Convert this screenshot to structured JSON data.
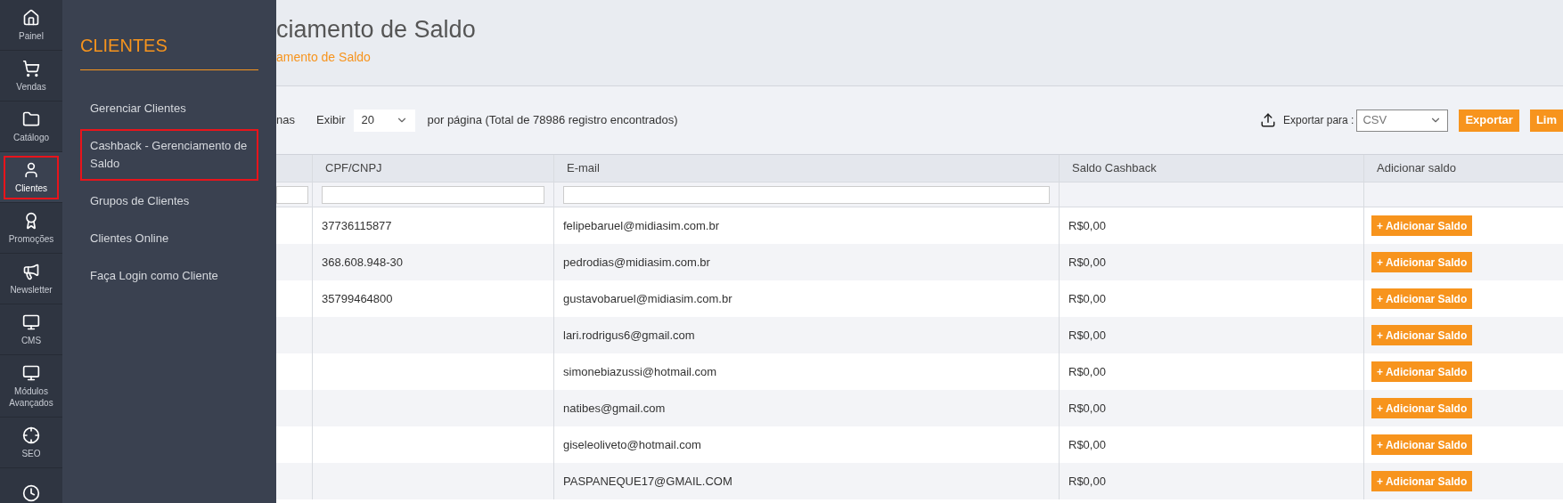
{
  "sidebar": {
    "items": [
      {
        "label": "Painel",
        "selected": false
      },
      {
        "label": "Vendas",
        "selected": false
      },
      {
        "label": "Catálogo",
        "selected": false
      },
      {
        "label": "Clientes",
        "selected": true
      },
      {
        "label": "Promoções",
        "selected": false
      },
      {
        "label": "Newsletter",
        "selected": false
      },
      {
        "label": "CMS",
        "selected": false
      },
      {
        "label": "Módulos Avançados",
        "selected": false
      },
      {
        "label": "SEO",
        "selected": false
      },
      {
        "selected": false
      }
    ]
  },
  "flyout": {
    "title": "CLIENTES",
    "items": [
      {
        "label": "Gerenciar Clientes",
        "selected": false
      },
      {
        "label": "Cashback - Gerenciamento de Saldo",
        "selected": true
      },
      {
        "label": "Grupos de Clientes",
        "selected": false
      },
      {
        "label": "Clientes Online",
        "selected": false
      },
      {
        "label": "Faça Login como Cliente",
        "selected": false
      }
    ]
  },
  "header": {
    "title": "ciamento de Saldo",
    "breadcrumb": "amento de Saldo"
  },
  "toolbar": {
    "pages_label": "nas",
    "show_label": "Exibir",
    "per_page": "20",
    "per_page_text": "por página (Total de 78986 registro encontrados)",
    "export_label": "Exportar para :",
    "export_format": "CSV",
    "buttons": [
      "Exportar",
      "Lim"
    ]
  },
  "table": {
    "columns": [
      "CPF/CNPJ",
      "E-mail",
      "Saldo Cashback",
      "Adicionar saldo"
    ],
    "rows": [
      {
        "cpf": "37736115877",
        "email": "felipebaruel@midiasim.com.br",
        "saldo": "R$0,00",
        "action": "+ Adicionar Saldo"
      },
      {
        "cpf": "368.608.948-30",
        "email": "pedrodias@midiasim.com.br",
        "saldo": "R$0,00",
        "action": "+ Adicionar Saldo"
      },
      {
        "cpf": "35799464800",
        "email": "gustavobaruel@midiasim.com.br",
        "saldo": "R$0,00",
        "action": "+ Adicionar Saldo"
      },
      {
        "email": "lari.rodrigus6@gmail.com",
        "saldo": "R$0,00",
        "action": "+ Adicionar Saldo"
      },
      {
        "email": "simonebiazussi@hotmail.com",
        "saldo": "R$0,00",
        "action": "+ Adicionar Saldo"
      },
      {
        "email": "natibes@gmail.com",
        "saldo": "R$0,00",
        "action": "+ Adicionar Saldo"
      },
      {
        "email": "giseleoliveto@hotmail.com",
        "saldo": "R$0,00",
        "action": "+ Adicionar Saldo"
      },
      {
        "email": "PASPANEQUE17@GMAIL.COM",
        "saldo": "R$0,00",
        "action": "+ Adicionar Saldo"
      }
    ]
  }
}
